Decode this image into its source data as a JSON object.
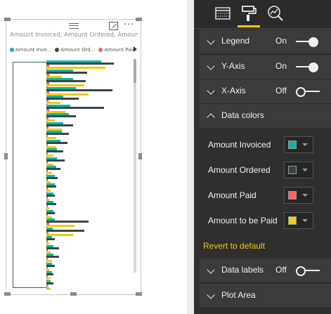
{
  "visual": {
    "title": "Amount Invoiced, Amount Ordered, Amount Pai...",
    "more_label": "···",
    "legend": [
      {
        "label": "Amount Invo...",
        "color": "#01b8aa"
      },
      {
        "label": "Amount Ord...",
        "color": "#374649"
      },
      {
        "label": "Amount Paid",
        "color": "#fd625e"
      }
    ]
  },
  "chart_data": {
    "type": "bar",
    "orientation": "horizontal",
    "title": "Amount Invoiced, Amount Ordered, Amount Pai...",
    "series": [
      {
        "name": "Amount Invoiced",
        "color": "#01b8aa",
        "values": [
          78,
          38,
          38,
          42,
          24,
          34,
          32,
          24,
          22,
          20,
          15,
          15,
          14,
          12,
          12,
          10,
          10,
          10,
          12,
          9,
          8,
          10,
          10,
          8,
          8,
          6,
          6
        ]
      },
      {
        "name": "Amount Ordered",
        "color": "#374649",
        "values": [
          96,
          58,
          56,
          94,
          46,
          82,
          42,
          38,
          32,
          30,
          24,
          26,
          20,
          16,
          14,
          12,
          14,
          12,
          60,
          54,
          12,
          18,
          18,
          12,
          10,
          10,
          8
        ]
      },
      {
        "name": "Amount Paid",
        "color": "#fd625e",
        "values": [
          4,
          4,
          4,
          4,
          3,
          4,
          3,
          3,
          2,
          2,
          2,
          2,
          2,
          2,
          2,
          2,
          2,
          2,
          4,
          3,
          2,
          2,
          2,
          2,
          2,
          2,
          2
        ]
      },
      {
        "name": "Amount to be Paid",
        "color": "#f2c811",
        "values": [
          84,
          22,
          54,
          60,
          20,
          28,
          12,
          22,
          14,
          14,
          10,
          10,
          8,
          6,
          6,
          4,
          4,
          8,
          40,
          38,
          4,
          6,
          8,
          4,
          6,
          4,
          4
        ]
      }
    ],
    "xlim": [
      0,
      120
    ],
    "legend_position": "top-left",
    "grid": false,
    "axis_labels_visible": false
  },
  "pane": {
    "tabs": [
      {
        "name": "fields-tab"
      },
      {
        "name": "format-tab",
        "active": true
      },
      {
        "name": "analytics-tab"
      }
    ],
    "sections": {
      "legend": {
        "label": "Legend",
        "state": "On"
      },
      "y_axis": {
        "label": "Y-Axis",
        "state": "On"
      },
      "x_axis": {
        "label": "X-Axis",
        "state": "Off"
      },
      "data_colors": {
        "label": "Data colors"
      },
      "data_labels": {
        "label": "Data labels",
        "state": "Off"
      },
      "plot_area": {
        "label": "Plot Area"
      }
    },
    "data_colors": [
      {
        "label": "Amount Invoiced",
        "color": "#01b8aa"
      },
      {
        "label": "Amount Ordered",
        "color": "#374649"
      },
      {
        "label": "Amount Paid",
        "color": "#fd625e"
      },
      {
        "label": "Amount to be Paid",
        "color": "#f2c811"
      }
    ],
    "revert_label": "Revert to default"
  },
  "colors": {
    "accent": "#f2c811",
    "pane_bg": "#2f2f2f",
    "section_bg": "#3b3b3b"
  }
}
